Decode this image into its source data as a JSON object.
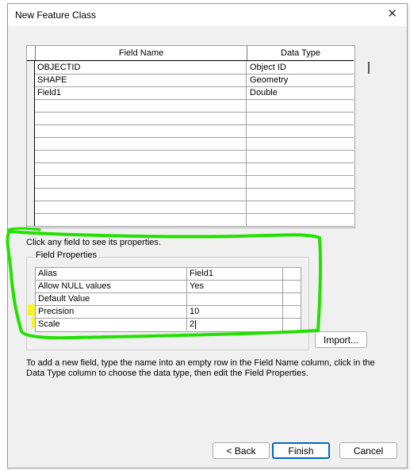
{
  "dialog": {
    "title": "New Feature Class",
    "close_glyph": "✕"
  },
  "fields_grid": {
    "columns": [
      "Field Name",
      "Data Type"
    ],
    "rows": [
      {
        "name": "OBJECTID",
        "type": "Object ID"
      },
      {
        "name": "SHAPE",
        "type": "Geometry"
      },
      {
        "name": "Field1",
        "type": "Double"
      },
      {
        "name": "",
        "type": ""
      },
      {
        "name": "",
        "type": ""
      },
      {
        "name": "",
        "type": ""
      },
      {
        "name": "",
        "type": ""
      },
      {
        "name": "",
        "type": ""
      },
      {
        "name": "",
        "type": ""
      },
      {
        "name": "",
        "type": ""
      },
      {
        "name": "",
        "type": ""
      },
      {
        "name": "",
        "type": ""
      },
      {
        "name": "",
        "type": ""
      }
    ]
  },
  "hint": "Click any field to see its properties.",
  "field_properties": {
    "group_label": "Field Properties",
    "rows": [
      {
        "name": "Alias",
        "value": "Field1"
      },
      {
        "name": "Allow NULL values",
        "value": "Yes"
      },
      {
        "name": "Default Value",
        "value": ""
      },
      {
        "name": "Precision",
        "value": "10"
      },
      {
        "name": "Scale",
        "value": "2"
      }
    ],
    "highlight_color": "#fff200",
    "annotation_color": "#22e000"
  },
  "buttons": {
    "import": "Import...",
    "back": "< Back",
    "finish": "Finish",
    "cancel": "Cancel"
  },
  "help_text": "To add a new field, type the name into an empty row in the Field Name column, click in the Data Type column to choose the data type, then edit the Field Properties."
}
